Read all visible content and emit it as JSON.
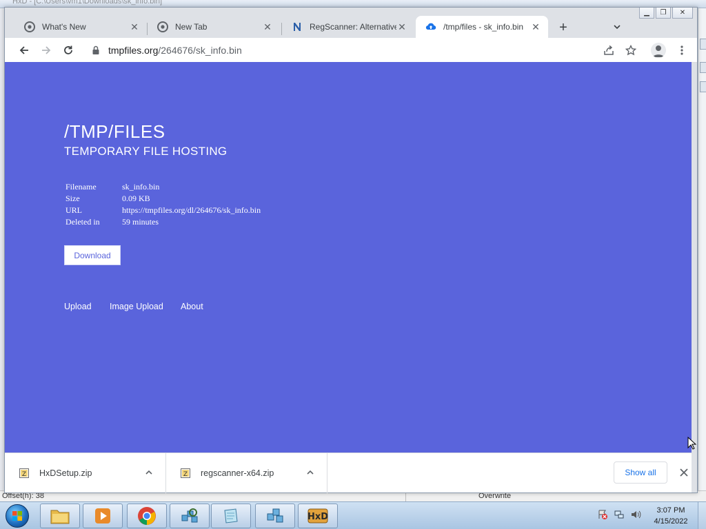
{
  "background_window": {
    "title_partial": "HxD - [C:\\Users\\vm1\\Downloads\\sk_info.bin]",
    "status_offset": "Offset(h): 38",
    "status_mode": "Overwrite"
  },
  "browser": {
    "tabs": [
      {
        "title": "What's New",
        "icon": "chrome-icon",
        "active": false
      },
      {
        "title": "New Tab",
        "icon": "chrome-icon",
        "active": false
      },
      {
        "title": "RegScanner: Alternative",
        "icon": "regscanner-icon",
        "active": false
      },
      {
        "title": "/tmp/files - sk_info.bin",
        "icon": "cloud-upload-icon",
        "active": true
      }
    ],
    "new_tab_symbol": "+",
    "tab_close_symbol": "✕",
    "url_host": "tmpfiles.org",
    "url_path": "/264676/sk_info.bin"
  },
  "page": {
    "title": "/TMP/FILES",
    "subtitle": "TEMPORARY FILE HOSTING",
    "file_info": [
      {
        "key": "Filename",
        "value": "sk_info.bin"
      },
      {
        "key": "Size",
        "value": "0.09 KB"
      },
      {
        "key": "URL",
        "value": "https://tmpfiles.org/dl/264676/sk_info.bin"
      },
      {
        "key": "Deleted in",
        "value": "59 minutes"
      }
    ],
    "download_label": "Download",
    "nav": [
      "Upload",
      "Image Upload",
      "About"
    ],
    "background_color": "#5a64dc"
  },
  "downloads": {
    "items": [
      {
        "name": "HxDSetup.zip"
      },
      {
        "name": "regscanner-x64.zip"
      }
    ],
    "show_all_label": "Show all"
  },
  "taskbar": {
    "apps": [
      "explorer-icon",
      "media-player-icon",
      "chrome-icon",
      "regscanner-icon",
      "notepad-icon",
      "regedit-icon",
      "hxd-icon"
    ],
    "time": "3:07 PM",
    "date": "4/15/2022"
  }
}
